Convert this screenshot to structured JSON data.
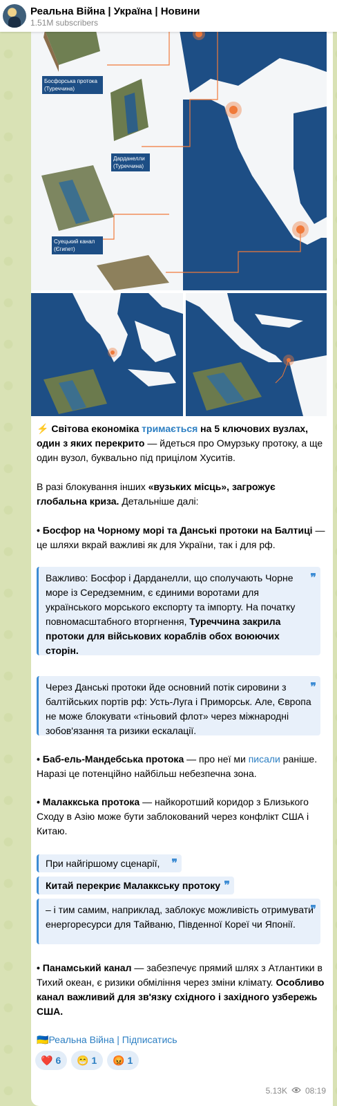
{
  "header": {
    "channel_title": "Реальна Війна | Україна | Новини",
    "subscribers": "1.51M subscribers"
  },
  "media": {
    "labels": {
      "bosporus": "Босфорська протока (Туреччина)",
      "dardanelles": "Дарданелли (Туреччина)",
      "suez": "Суецький канал (Єгипет)"
    }
  },
  "post": {
    "p1_emoji": "⚡",
    "p1_a": " Світова економіка ",
    "p1_link": "тримається",
    "p1_b": " на 5 ключових вузлах, один з яких перекрито",
    "p1_c": " — йдеться про Омурзьку протоку, а ще один вузол, буквально під прицілом Хуситів.",
    "p2_a": "В разі блокування інших ",
    "p2_b": "«вузьких місць», загрожує глобальна криза.",
    "p2_c": " Детальніше далі:",
    "p3_a": "• Босфор на Чорному морі та Данські протоки на Балтиці",
    "p3_b": " — це шляхи вкрай важливі як для України, так і для рф.",
    "q1_a": "Важливо: Босфор і Дарданелли, що сполучають Чорне море із Середземним, є єдиними воротами для українського морського експорту та імпорту. На початку повномасштабного вторгнення, ",
    "q1_b": "Туреччина закрила протоки для військових кораблів обох воюючих сторін.",
    "q2": "Через Данські протоки йде основний потік сировини з балтійських портів рф: Усть-Луга і Приморськ. Але, Європа не може блокувати «тіньовий флот» через міжнародні зобов'язання та ризики ескалації.",
    "p4_a": "• Баб-ель-Мандебська протока",
    "p4_b": " — про неї ми ",
    "p4_link": "писали",
    "p4_c": " раніше. Наразі це потенційно найбільш небезпечна зона.",
    "p5_a": "• Малаккська протока",
    "p5_b": " — найкоротший коридор з Близького Сходу в Азію може бути заблокований через конфлікт США і Китаю.",
    "q3": "При найгіршому сценарії,",
    "q4": "Китай перекриє Малаккську протоку",
    "q5": "– і тим самим, наприклад, заблокує можливість отримувати енергоресурси для Тайваню, Південної Кореї чи Японії.",
    "p6_a": "• Панамський канал",
    "p6_b": " — забезпечує прямий шлях з Атлантики в Тихий океан, є ризики обміління через зміни клімату. ",
    "p6_c": "Особливо канал важливий для зв'язку східного і західного узбережь США.",
    "footer_flag": "🇺🇦",
    "footer_link": "Реальна Війна | Підписатись"
  },
  "reactions": [
    {
      "emoji": "❤️",
      "count": "6"
    },
    {
      "emoji": "😁",
      "count": "1"
    },
    {
      "emoji": "😡",
      "count": "1"
    }
  ],
  "meta": {
    "views": "5.13K",
    "time": "08:19"
  },
  "colors": {
    "sea": "#1d4e85",
    "land": "#f4f6f8",
    "marker": "#f07a3a",
    "link": "#2b7ec2"
  }
}
